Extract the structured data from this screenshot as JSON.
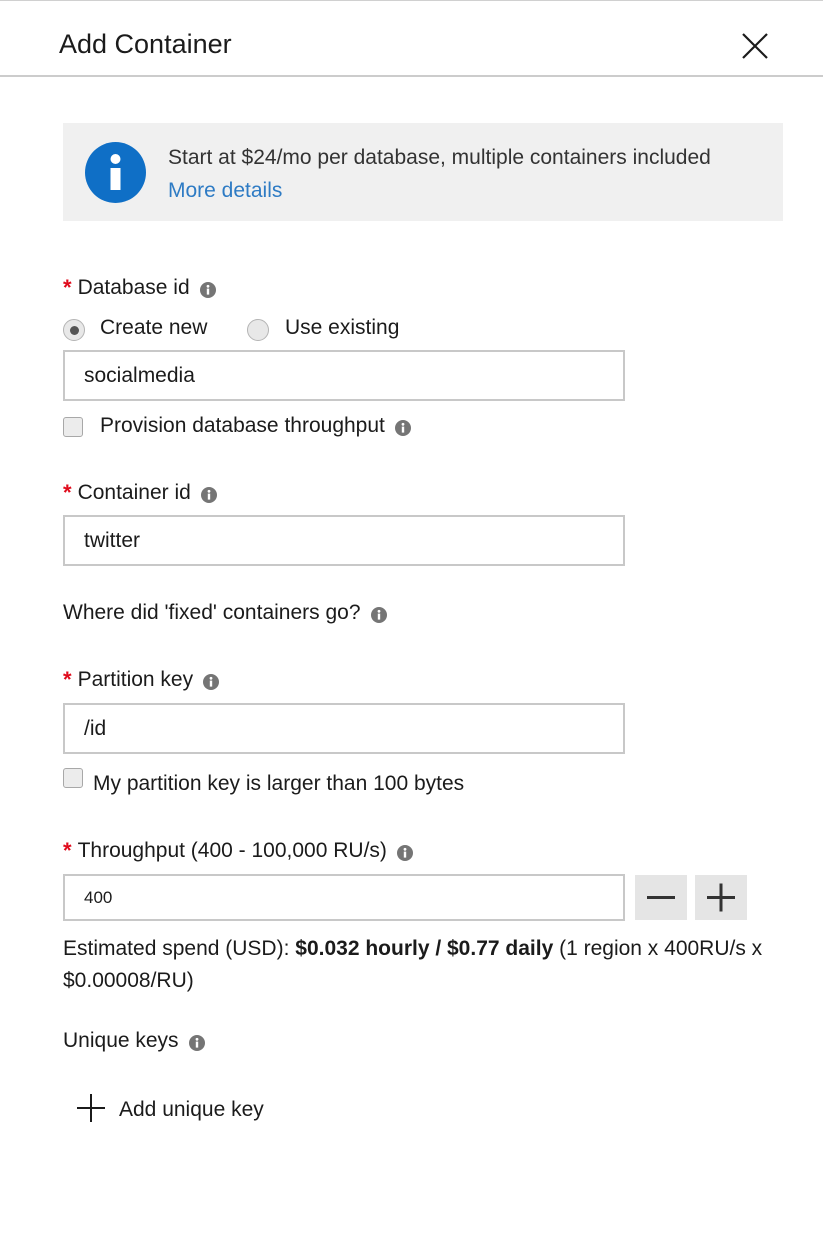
{
  "panel": {
    "title": "Add Container",
    "close_icon": "close-icon"
  },
  "info": {
    "icon": "info-icon",
    "message": "Start at $24/mo per database, multiple containers included",
    "link": "More details"
  },
  "database": {
    "label": "Database id",
    "options": [
      "Create new",
      "Use existing"
    ],
    "selected": "Create new",
    "value": "socialmedia",
    "provision_label": "Provision database throughput",
    "provision_checked": false
  },
  "container": {
    "label": "Container id",
    "value": "twitter"
  },
  "fixed_question": "Where did 'fixed' containers go?",
  "partition": {
    "label": "Partition key",
    "value": "/id",
    "large_key_label": "My partition key is larger than 100 bytes",
    "large_key_checked": false
  },
  "throughput": {
    "label": "Throughput (400 - 100,000 RU/s)",
    "value": "400",
    "decrement_icon": "minus-icon",
    "increment_icon": "plus-icon"
  },
  "estimate": {
    "prefix": "Estimated spend (USD): ",
    "bold": "$0.032 hourly / $0.77 daily",
    "suffix": " (1 region x 400RU/s x $0.00008/RU)"
  },
  "unique_keys": {
    "label": "Unique keys",
    "add_label": "Add unique key"
  },
  "colors": {
    "required": "#e00b1c",
    "info_blue": "#0f6fc6",
    "link": "#2e7bc4",
    "banner_bg": "#f0f0f0"
  }
}
